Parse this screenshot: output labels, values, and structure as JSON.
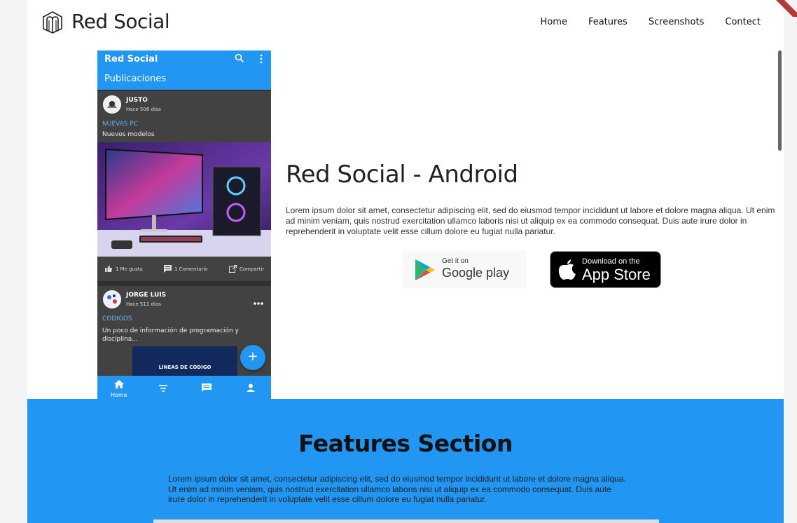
{
  "nav": {
    "brand": "Red Social",
    "links": [
      "Home",
      "Features",
      "Screenshots",
      "Contect"
    ]
  },
  "phone": {
    "app_title": "Red Social",
    "section_title": "Publicaciones",
    "posts": [
      {
        "author": "JUSTO",
        "time": "Hace 506 días",
        "title": "NUEVAS PC",
        "desc": "Nuevos modelos",
        "actions": [
          "1 Me gusta",
          "1 Comentario",
          "Compartir"
        ]
      },
      {
        "author": "JORGE LUIS",
        "time": "Hace 511 días",
        "title": "CODIGOS",
        "desc": "Un poco de información de programación y disciplina...",
        "image_text": "LÍNEAS DE CÓDIGO"
      }
    ],
    "fab": "+",
    "bottom_nav_label": "Home"
  },
  "hero": {
    "title": "Red Social - Android",
    "desc": "Lorem ipsum dolor sit amet, consectetur adipiscing elit, sed do eiusmod tempor incididunt ut labore et dolore magna aliqua. Ut enim ad minim veniam, quis nostrud exercitation ullamco laboris nisi ut aliquip ex ea commodo consequat. Duis aute irure dolor in reprehenderit in voluptate velit esse cillum dolore eu fugiat nulla pariatur.",
    "google_play": {
      "small": "Get it on",
      "big": "Google play"
    },
    "app_store": {
      "small": "Download on the",
      "big": "App Store"
    }
  },
  "features": {
    "title": "Features Section",
    "desc": "Lorem ipsum dolor sit amet, consectetur adipiscing elit, sed do eiusmod tempor incididunt ut labore et dolore magna aliqua. Ut enim ad minim veniam, quis nostrud exercitation ullamco laboris nisi ut aliquip ex ea commodo consequat. Duis aute irure dolor in reprehenderit in voluptate velit esse cillum dolore eu fugiat nulla pariatur."
  },
  "colors": {
    "primary": "#2196F3",
    "dark": "#303030",
    "card": "#424242"
  }
}
